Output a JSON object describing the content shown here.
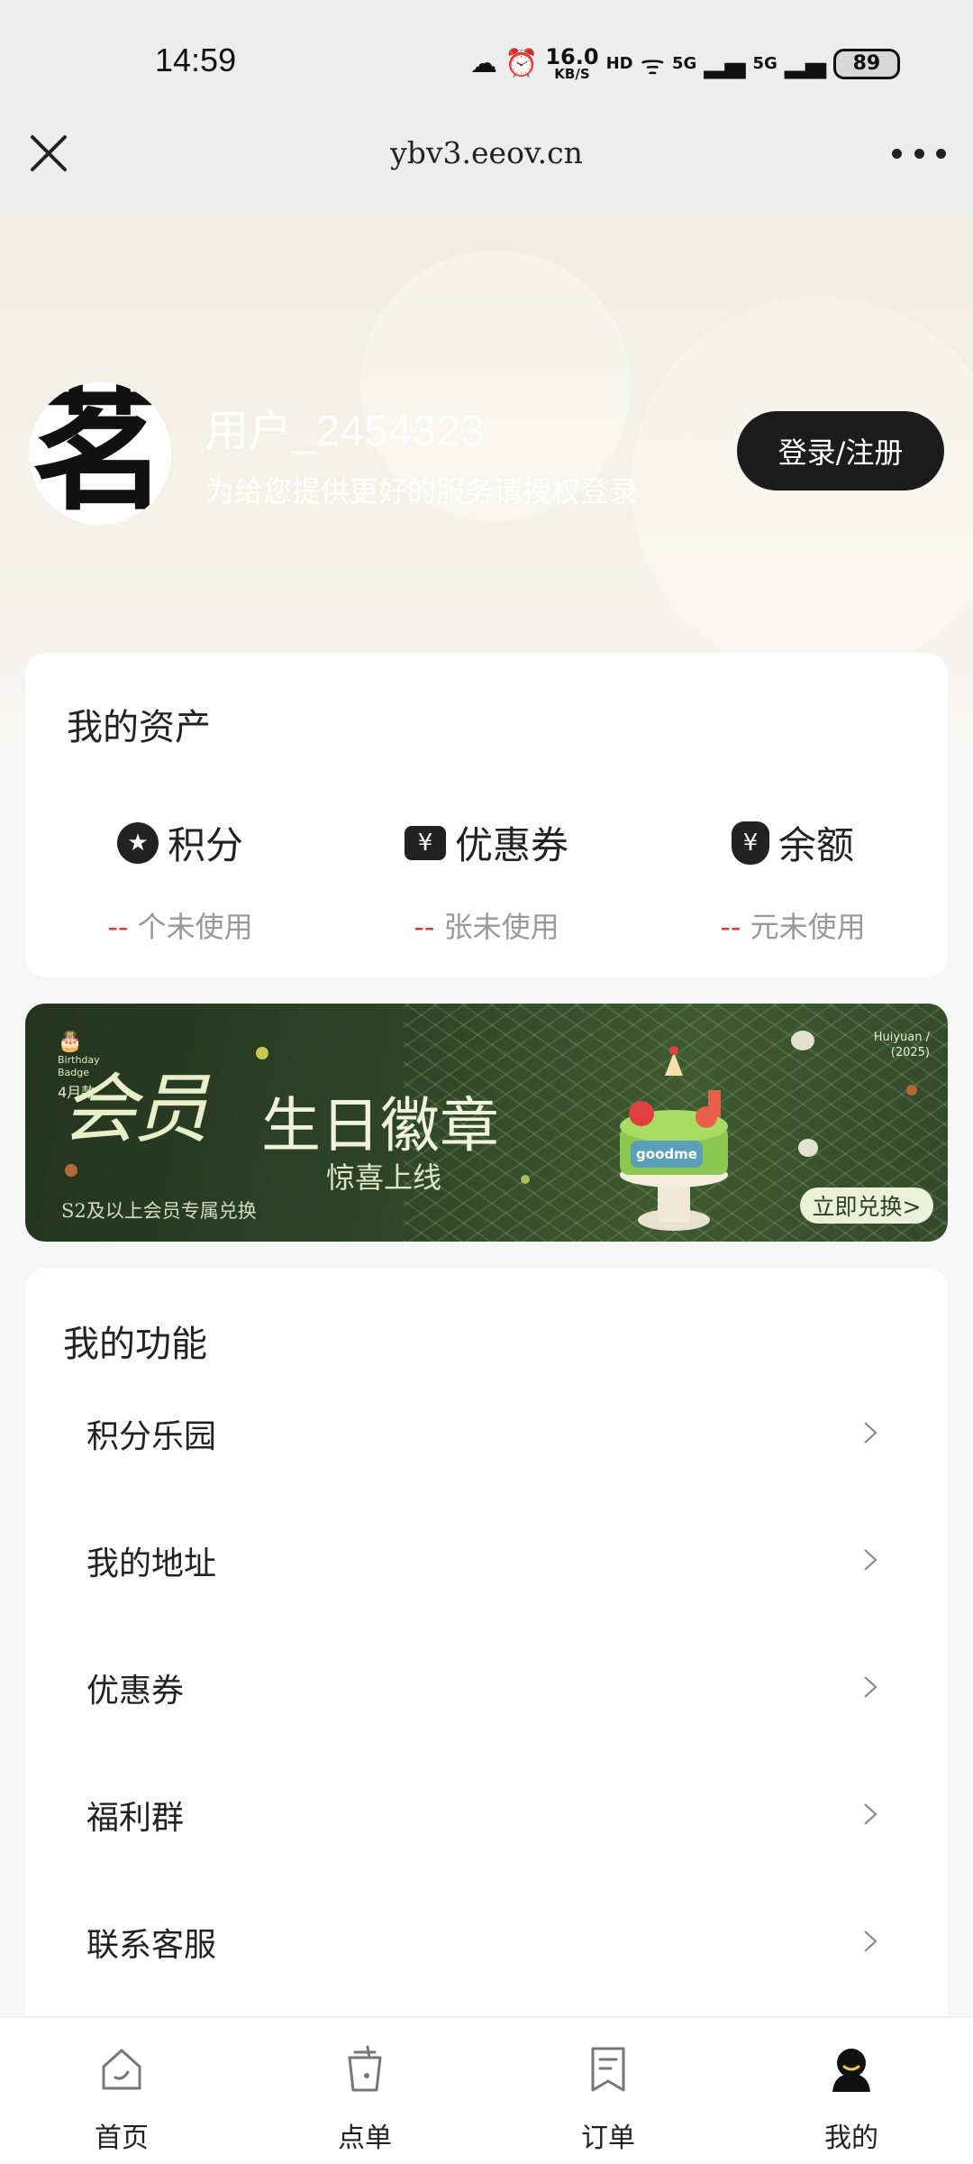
{
  "status_bar": {
    "time": "14:59",
    "net_speed_value": "16.0",
    "net_speed_unit": "KB/S",
    "hd_label": "HD",
    "signal_1": "5G",
    "signal_2": "5G",
    "battery": "89"
  },
  "title_bar": {
    "url": "ybv3.eeov.cn",
    "close_icon": "close-icon",
    "more_icon": "more-icon"
  },
  "profile": {
    "avatar_char": "茗",
    "username": "用户_2454323",
    "login_hint": "为给您提供更好的服务请授权登录",
    "login_button": "登录/注册"
  },
  "assets": {
    "title": "我的资产",
    "items": [
      {
        "icon": "star-icon",
        "label": "积分",
        "value": "--",
        "unit": "个未使用"
      },
      {
        "icon": "coupon-icon",
        "label": "优惠券",
        "value": "--",
        "unit": "张未使用"
      },
      {
        "icon": "money-bag-icon",
        "label": "余额",
        "value": "--",
        "unit": "元未使用"
      }
    ]
  },
  "banner": {
    "badge_line1": "Birthday",
    "badge_line2": "Badge",
    "badge_month": "4月款",
    "script_title": "会员",
    "title": "生日徽章",
    "subtitle": "惊喜上线",
    "note": "S2及以上会员专属兑换",
    "brand_line1": "Huiyuan /",
    "brand_line2": "(2025)",
    "cake_label": "goodme",
    "cta": "立即兑换>"
  },
  "functions": {
    "title": "我的功能",
    "items": [
      "积分乐园",
      "我的地址",
      "优惠券",
      "福利群",
      "联系客服"
    ]
  },
  "bottom_nav": {
    "items": [
      {
        "label": "首页",
        "icon": "home-icon",
        "active": false
      },
      {
        "label": "点单",
        "icon": "cup-icon",
        "active": false
      },
      {
        "label": "订单",
        "icon": "order-receipt-icon",
        "active": false
      },
      {
        "label": "我的",
        "icon": "profile-icon",
        "active": true
      }
    ]
  },
  "colors": {
    "accent_dark": "#1c1c1c",
    "dash_red": "#e53935",
    "banner_green": "#2e4426"
  }
}
